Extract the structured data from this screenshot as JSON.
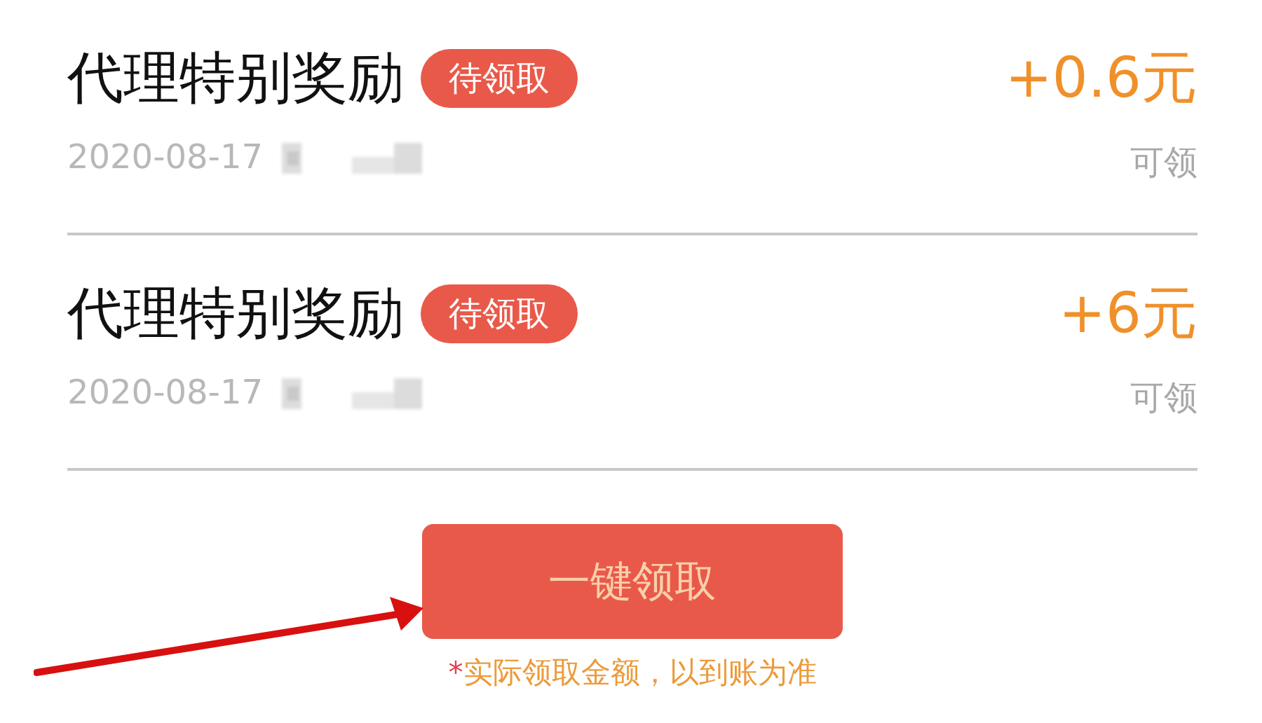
{
  "rewards": [
    {
      "title": "代理特别奖励",
      "badge": "待领取",
      "date": "2020-08-17",
      "amount": "+0.6元",
      "status": "可领"
    },
    {
      "title": "代理特别奖励",
      "badge": "待领取",
      "date": "2020-08-17",
      "amount": "+6元",
      "status": "可领"
    }
  ],
  "claim_button": "一键领取",
  "note": {
    "mark": "*",
    "text": "实际领取金额，以到账为准"
  }
}
